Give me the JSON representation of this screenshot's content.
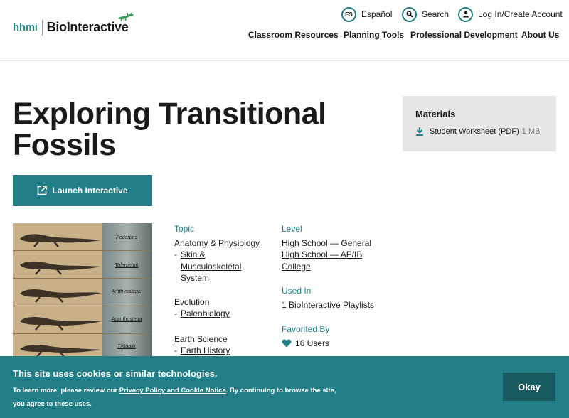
{
  "header": {
    "logo_hhmi": "hhmi",
    "logo_bio": "BioInteractive",
    "espanol_badge": "ES",
    "espanol_label": "Español",
    "search_label": "Search",
    "login_label": "Log In/Create Account",
    "nav": [
      "Classroom Resources",
      "Planning Tools",
      "Professional Development",
      "About Us"
    ]
  },
  "page": {
    "title": "Exploring Transitional Fossils",
    "launch_label": "Launch Interactive"
  },
  "materials": {
    "heading": "Materials",
    "file_label": "Student Worksheet (PDF)",
    "file_size": "1 MB"
  },
  "thumbnail": {
    "captions": [
      "Pederpes",
      "Tulerpeton",
      "Ichthyostega",
      "Acanthostega",
      "Tiktaalik"
    ]
  },
  "topic": {
    "heading": "Topic",
    "items": [
      {
        "label": "Anatomy & Physiology",
        "sub": [
          "Skin &",
          "Musculoskeletal",
          "System"
        ]
      },
      {
        "label": "Evolution",
        "sub": [
          "Paleobiology"
        ]
      },
      {
        "label": "Earth Science",
        "sub": [
          "Earth History"
        ]
      }
    ]
  },
  "level": {
    "heading": "Level",
    "items": [
      "High School — General",
      "High School — AP/IB",
      "College"
    ]
  },
  "used_in": {
    "heading": "Used In",
    "value": "1 BioInteractive Playlists"
  },
  "favorited": {
    "heading": "Favorited By",
    "value": "16 Users"
  },
  "colors": {
    "accent": "#237f87",
    "button_dark": "#17595f",
    "materials_bg": "#e7e7e7"
  },
  "cookie": {
    "title": "This site uses cookies or similar technologies.",
    "text_before": "To learn more, please review our ",
    "link": "Privacy Policy and Cookie Notice",
    "text_after": ". By continuing to browse the site, you agree to these uses.",
    "ok_label": "Okay"
  }
}
